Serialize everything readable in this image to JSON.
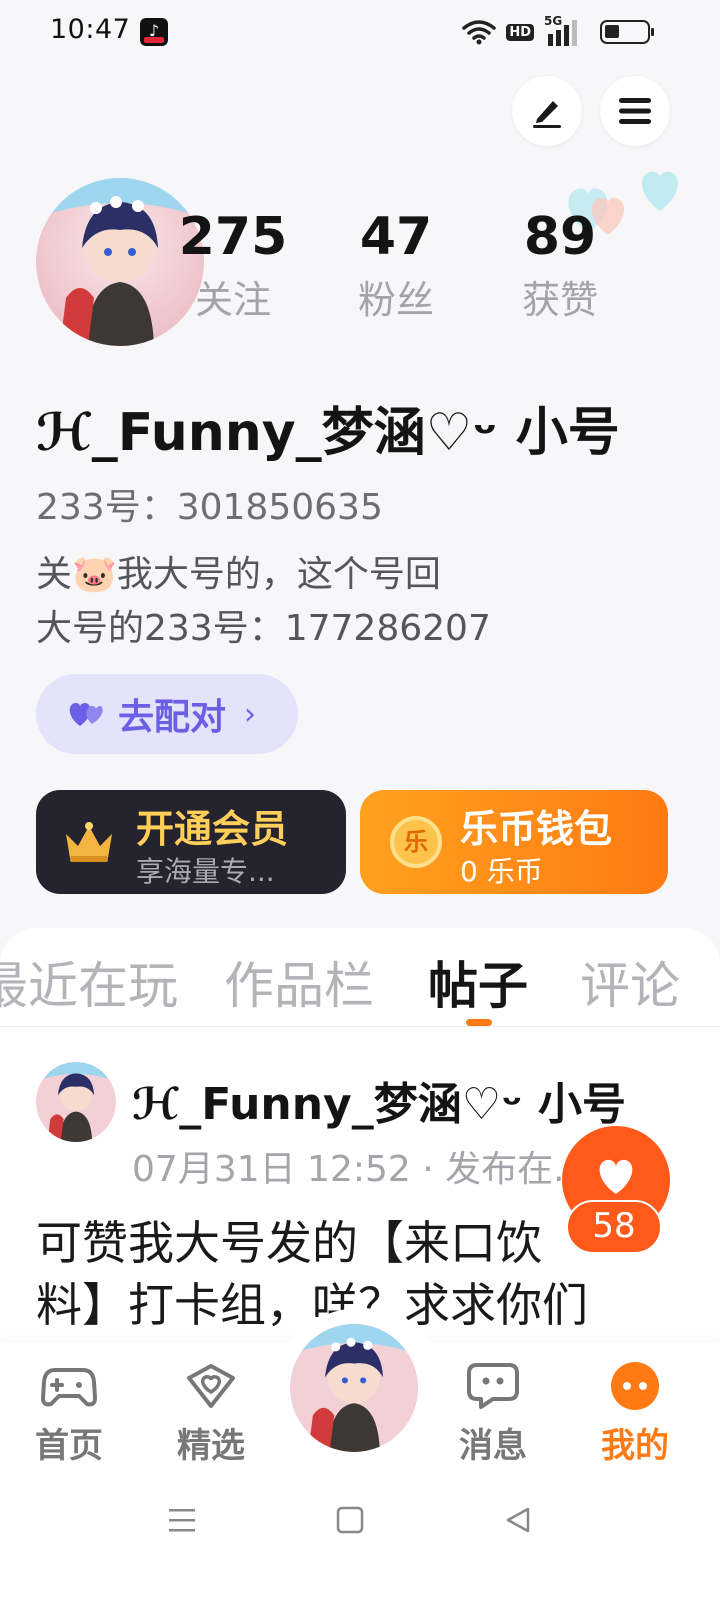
{
  "status_bar": {
    "time": "10:47",
    "tiktok_glyph": "♪",
    "hd": "HD",
    "network": "5G"
  },
  "icons": {
    "edit": "pencil-icon",
    "menu": "hamburger-menu-icon",
    "pair": "double-heart-icon",
    "vip": "crown-icon",
    "wallet": "coin-icon"
  },
  "stats": [
    {
      "value": "275",
      "label": "关注"
    },
    {
      "value": "47",
      "label": "粉丝"
    },
    {
      "value": "89",
      "label": "获赞"
    }
  ],
  "profile": {
    "username": "ℋ_Funny_梦涵♡ᵕ 小号",
    "id_line": "233号：301850635",
    "bio_line1": "关🐷我大号的，这个号回",
    "bio_line2": "大号的233号：177286207"
  },
  "pair_button": {
    "label": "去配对",
    "chevron": "›"
  },
  "vip_card": {
    "title": "开通会员",
    "subtitle": "享海量专...",
    "coin_glyph": "乐"
  },
  "wallet_card": {
    "title": "乐币钱包",
    "subtitle": "0 乐币",
    "coin_glyph": "乐"
  },
  "tabs": [
    {
      "label": "最近在玩"
    },
    {
      "label": "作品栏"
    },
    {
      "label": "帖子"
    },
    {
      "label": "评论"
    }
  ],
  "active_tab": "帖子",
  "post": {
    "author": "ℋ_Funny_梦涵♡ᵕ 小号",
    "meta": "07月31日 12:52 · 发布在...",
    "body_line1": "可赞我大号发的【来口饮",
    "body_line2": "料】打卡组，咩？求求你们"
  },
  "like_fab": {
    "count": "58"
  },
  "bottom_nav": [
    {
      "label": "首页",
      "icon": "gamepad-icon"
    },
    {
      "label": "精选",
      "icon": "heart-badge-icon"
    },
    {
      "label": "消息",
      "icon": "chat-bubble-icon"
    },
    {
      "label": "我的",
      "icon": "profile-dots-icon"
    }
  ],
  "colors": {
    "accent": "#ff7a12",
    "pair": "#6b5fe6",
    "vip_bg": "#24232e",
    "vip_text": "#ffcf5a",
    "like": "#ff5a1a"
  }
}
